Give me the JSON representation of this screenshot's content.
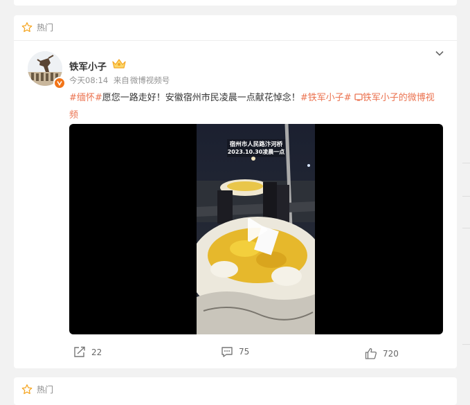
{
  "sections": {
    "hot_label": "热门"
  },
  "post": {
    "username": "铁军小子",
    "time": "今天08:14",
    "source_prefix": "来自",
    "source": "微博视频号",
    "text": {
      "tag1": "#缅怀#",
      "body": "愿您一路走好！安徽宿州市民凌晨一点献花悼念！",
      "tag2": "#铁军小子#",
      "link_icon": "link-video-icon",
      "link_text": "铁军小子的微博视频"
    },
    "video": {
      "overlay_line1": "宿州市人民路汴河桥",
      "overlay_line2": "2023.10.30凌晨一点"
    },
    "stats": {
      "shares": "22",
      "comments": "75",
      "likes": "720"
    }
  },
  "colors": {
    "tag_color": "#eb7350",
    "badge_color": "#f27418",
    "crown_color": "#f5a623"
  },
  "icons": [
    "star-icon",
    "crown-icon",
    "chevron-down-icon",
    "share-icon",
    "comment-icon",
    "like-icon",
    "play-icon"
  ]
}
